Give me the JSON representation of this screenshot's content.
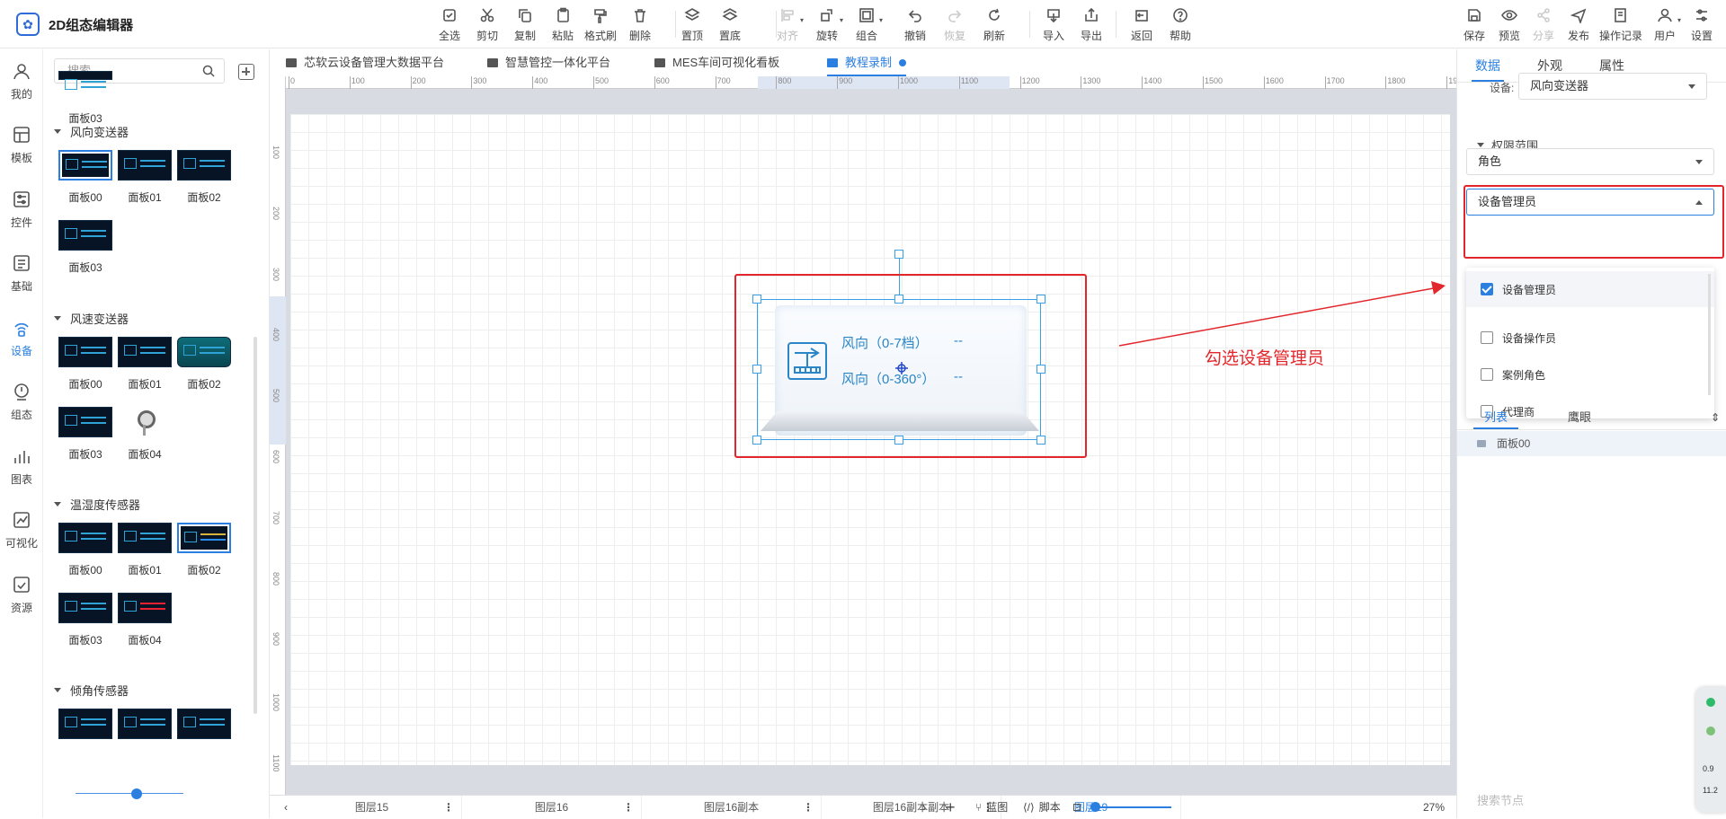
{
  "app": {
    "title": "2D组态编辑器",
    "brand_color": "#2a7fe0",
    "annotation_color": "#e3262b"
  },
  "toolbar_center": [
    {
      "label": "全选",
      "icon": "select-all-icon",
      "enabled": true
    },
    {
      "label": "剪切",
      "icon": "scissors-icon",
      "enabled": true
    },
    {
      "label": "复制",
      "icon": "copy-icon",
      "enabled": true
    },
    {
      "label": "粘贴",
      "icon": "paste-icon",
      "enabled": true
    },
    {
      "label": "格式刷",
      "icon": "format-brush-icon",
      "enabled": true
    },
    {
      "label": "删除",
      "icon": "trash-icon",
      "enabled": true
    },
    {
      "label": "置顶",
      "icon": "bring-to-front-icon",
      "enabled": true
    },
    {
      "label": "置底",
      "icon": "send-to-back-icon",
      "enabled": true
    },
    {
      "label": "对齐",
      "icon": "align-icon",
      "enabled": false
    },
    {
      "label": "旋转",
      "icon": "rotate-icon",
      "enabled": true
    },
    {
      "label": "组合",
      "icon": "group-icon",
      "enabled": true
    },
    {
      "label": "撤销",
      "icon": "undo-icon",
      "enabled": true
    },
    {
      "label": "恢复",
      "icon": "redo-icon",
      "enabled": false
    },
    {
      "label": "刷新",
      "icon": "refresh-icon",
      "enabled": true
    },
    {
      "label": "导入",
      "icon": "import-icon",
      "enabled": true
    },
    {
      "label": "导出",
      "icon": "export-icon",
      "enabled": true
    },
    {
      "label": "返回",
      "icon": "back-icon",
      "enabled": true
    },
    {
      "label": "帮助",
      "icon": "help-icon",
      "enabled": true
    }
  ],
  "toolbar_right": [
    {
      "label": "保存",
      "icon": "save-icon",
      "enabled": true
    },
    {
      "label": "预览",
      "icon": "preview-icon",
      "enabled": true
    },
    {
      "label": "分享",
      "icon": "share-icon",
      "enabled": false
    },
    {
      "label": "发布",
      "icon": "publish-icon",
      "enabled": true
    },
    {
      "label": "操作记录",
      "icon": "history-icon",
      "enabled": true
    },
    {
      "label": "用户",
      "icon": "user-icon",
      "enabled": true
    },
    {
      "label": "设置",
      "icon": "settings-icon",
      "enabled": true
    }
  ],
  "leftnav": [
    {
      "label": "我的",
      "icon": "user-circle-icon",
      "active": false
    },
    {
      "label": "模板",
      "icon": "template-icon",
      "active": false
    },
    {
      "label": "控件",
      "icon": "controls-icon",
      "active": false
    },
    {
      "label": "基础",
      "icon": "basic-icon",
      "active": false
    },
    {
      "label": "设备",
      "icon": "device-icon",
      "active": true
    },
    {
      "label": "组态",
      "icon": "config-icon",
      "active": false
    },
    {
      "label": "图表",
      "icon": "chart-icon",
      "active": false
    },
    {
      "label": "可视化",
      "icon": "visualization-icon",
      "active": false
    },
    {
      "label": "资源",
      "icon": "resource-icon",
      "active": false
    }
  ],
  "palette": {
    "search_placeholder": "搜索",
    "top_fragment_label": "面板03",
    "groups": [
      {
        "name": "风向变送器",
        "items": [
          "面板00",
          "面板01",
          "面板02",
          "面板03"
        ],
        "selected": 0
      },
      {
        "name": "风速变送器",
        "items": [
          "面板00",
          "面板01",
          "面板02",
          "面板03",
          "面板04"
        ],
        "selected": -1
      },
      {
        "name": "温湿度传感器",
        "items": [
          "面板00",
          "面板01",
          "面板02",
          "面板03",
          "面板04"
        ],
        "selected": 2
      },
      {
        "name": "倾角传感器",
        "items": [],
        "selected": -1
      }
    ]
  },
  "tabs": [
    {
      "label": "芯软云设备管理大数据平台",
      "active": false
    },
    {
      "label": "智慧管控一体化平台",
      "active": false
    },
    {
      "label": "MES车间可视化看板",
      "active": false
    },
    {
      "label": "教程录制",
      "active": true
    }
  ],
  "ruler": {
    "h_ticks": [
      "0",
      "100",
      "200",
      "300",
      "400",
      "500",
      "600",
      "700",
      "800",
      "900",
      "1000",
      "1100",
      "1200",
      "1300",
      "1400",
      "1500",
      "1600",
      "1700",
      "1800",
      "1900"
    ],
    "v_ticks": [
      "100",
      "200",
      "300",
      "400",
      "500",
      "600",
      "700",
      "800",
      "900",
      "1000",
      "1100"
    ]
  },
  "component": {
    "row1_label": "风向（0-7档）",
    "row1_value": "--",
    "row2_label": "风向（0-360°）",
    "row2_value": "--"
  },
  "annotation": {
    "text": "勾选设备管理员"
  },
  "bottombar": {
    "layers": [
      {
        "label": "图层15",
        "active": false
      },
      {
        "label": "图层16",
        "active": false
      },
      {
        "label": "图层16副本",
        "active": false
      },
      {
        "label": "图层16副本副本",
        "active": false
      },
      {
        "label": "图层19",
        "active": true
      }
    ],
    "blueprint_label": "蓝图",
    "script_label": "脚本",
    "zoom_label": "27%",
    "zoom_value": 0.27
  },
  "right_panel": {
    "tabs": [
      {
        "label": "数据",
        "active": true
      },
      {
        "label": "外观",
        "active": false
      },
      {
        "label": "属性",
        "active": false
      }
    ],
    "device_label": "设备:",
    "device_value": "风向变送器",
    "permission_section": "权限范围",
    "role_select_value": "角色",
    "role_member_select_value": "设备管理员",
    "options": [
      {
        "label": "设备管理员",
        "checked": true
      },
      {
        "label": "设备操作员",
        "checked": false
      },
      {
        "label": "案例角色",
        "checked": false
      },
      {
        "label": "代理商",
        "checked": false
      }
    ],
    "tree_tabs": [
      {
        "label": "列表",
        "active": true
      },
      {
        "label": "鹰眼",
        "active": false
      }
    ],
    "tree_items": [
      "面板00"
    ],
    "search_node_placeholder": "搜索节点"
  },
  "float_widget": {
    "line1": "0.9",
    "line2": "11.2"
  }
}
